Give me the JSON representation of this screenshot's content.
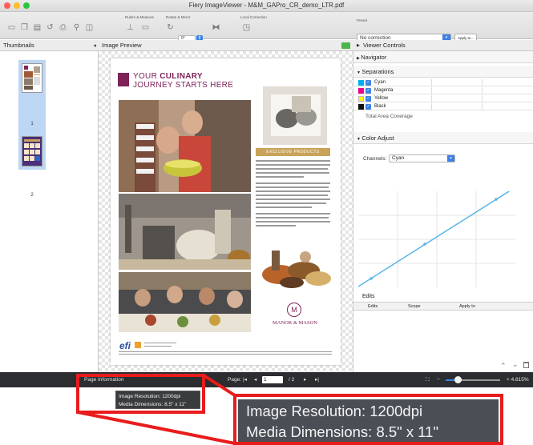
{
  "window": {
    "title": "Fiery ImageViewer - M&M_GAPro_CR_demo_LTR.pdf",
    "traffic_lights": {
      "close": "#fe5f57",
      "minimize": "#febc2e",
      "zoom": "#28c840"
    }
  },
  "toolbar": {
    "group_rulers": "Rulers & Measure",
    "group_rotate": "Rotate & Mirror",
    "group_local": "Local Correction",
    "rotate_value": "0°",
    "preset_label": "Preset",
    "preset_value": "No correction",
    "apply_label": "Apply to..."
  },
  "panels": {
    "thumbnails_title": "Thumbnails",
    "preview_title": "Image Preview",
    "thumbnails": [
      {
        "page": "1",
        "selected": true
      },
      {
        "page": "2",
        "selected": false
      }
    ]
  },
  "document": {
    "headline_1a": "YOUR",
    "headline_1b": "CULINARY",
    "headline_2": "JOURNEY STARTS HERE",
    "exclusive_label": "EXCLUSIVE PRODUCTS",
    "manor_emblem": "M",
    "manor_name": "MANOR & MASON",
    "efi_logo": "efi",
    "brand_color": "#7e2358",
    "accent_color": "#c9a35a"
  },
  "right_panel": {
    "viewer_controls": "Viewer Controls",
    "navigator": "Navigator",
    "separations": "Separations",
    "separation_items": [
      {
        "name": "Cyan",
        "color": "#00aeef"
      },
      {
        "name": "Magenta",
        "color": "#ec008c"
      },
      {
        "name": "Yellow",
        "color": "#fff200"
      },
      {
        "name": "Black",
        "color": "#111111"
      }
    ],
    "total_area_coverage": "Total Area Coverage",
    "color_adjust": "Color Adjust",
    "channels_label": "Channels:",
    "channels_value": "Cyan",
    "edits_title": "Edits",
    "edits_columns": [
      "Edits",
      "Scope",
      "Apply to"
    ]
  },
  "bottombar": {
    "page_information": "Page Information",
    "page_label": "Page:",
    "page_current": "1",
    "page_total": "/ 2",
    "zoom_value": "+ 4.815%"
  },
  "tooltip": {
    "resolution": "Image Resolution: 1200dpi",
    "dimensions": "Media Dimensions: 8.5\" x 11\""
  },
  "annotation": {
    "highlight_color": "#e81c1c"
  }
}
